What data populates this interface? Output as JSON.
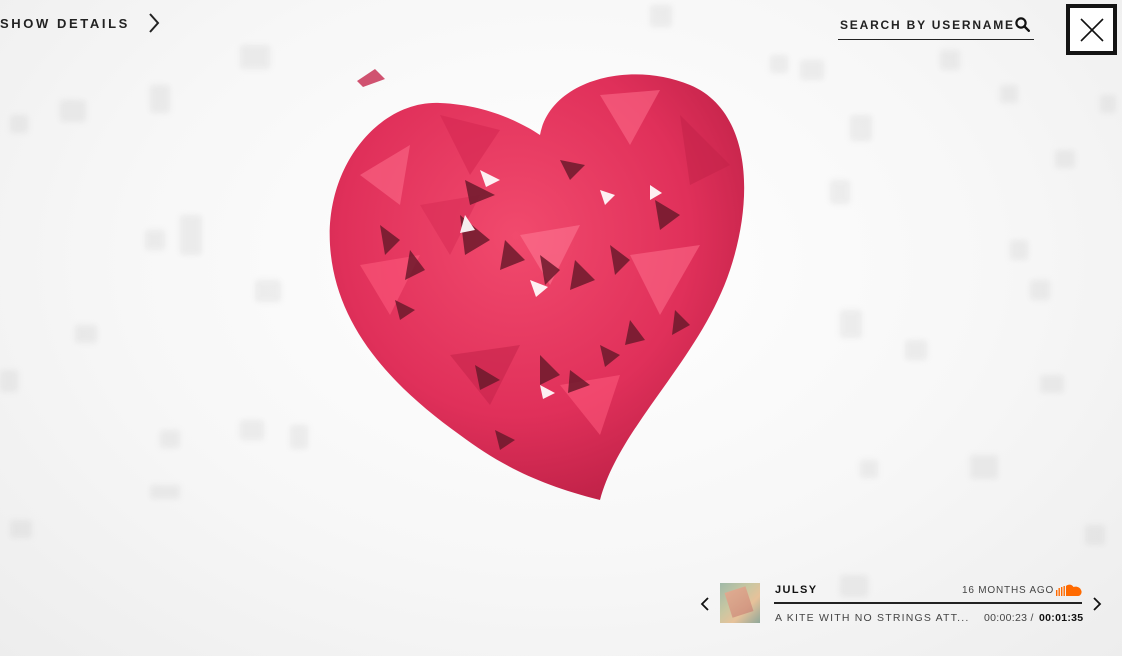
{
  "header": {
    "show_details_label": "SHOW DETAILS",
    "show_details_icon": "chevron-right-icon",
    "search_label": "SEARCH BY USERNAME",
    "search_icon": "search-icon",
    "close_icon": "close-icon"
  },
  "visual": {
    "heart_color": "#e8345c",
    "heart_shadow_color": "#a81f3d"
  },
  "player": {
    "prev_icon": "chevron-left-icon",
    "next_icon": "chevron-right-icon",
    "artist": "JULSY",
    "posted_ago": "16 MONTHS AGO",
    "source_icon": "soundcloud-icon",
    "track_title": "A KITE WITH NO STRINGS ATT...",
    "time_current": "00:00:23 /",
    "time_total": "00:01:35"
  }
}
